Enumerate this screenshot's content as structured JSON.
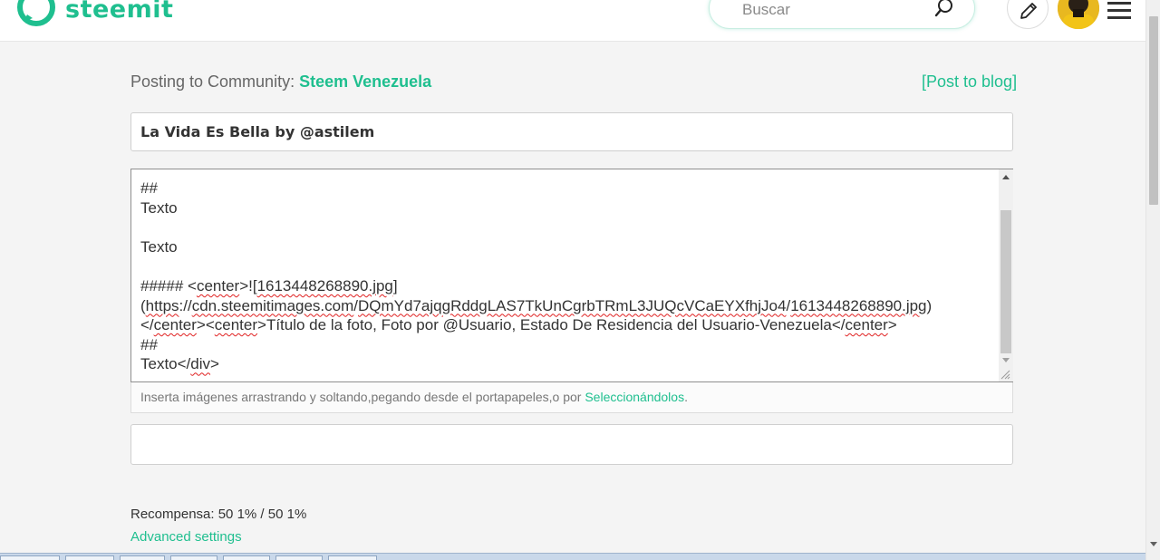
{
  "header": {
    "logo_text": "steemit",
    "search_placeholder": "Buscar"
  },
  "editor_meta": {
    "posting_prefix": "Posting to Community:",
    "community_name": "Steem Venezuela",
    "post_to_blog": "[Post to blog]"
  },
  "title_value": "La Vida Es Bella by @astilem",
  "body_lines": {
    "l1": "##",
    "l2": "Texto",
    "l4": "Texto",
    "l6_a": "##### <",
    "l6_b": "center",
    "l6_c": ">![",
    "l6_d": "1613448268890.jpg",
    "l6_e": "]",
    "l7_a": "(",
    "l7_b": "https",
    "l7_c": "://",
    "l7_d": "cdn.steemitimages.com",
    "l7_e": "/",
    "l7_f": "DQmYd7ajqgRddgLAS7TkUnCgrbTRmL3JUQcVCaEYXfhjJo4",
    "l7_g": "/",
    "l7_h": "1613448268890.jpg",
    "l7_i": ")",
    "l8_a": "</",
    "l8_b": "center",
    "l8_c": "><",
    "l8_d": "center",
    "l8_e": ">Título de la foto, Foto por @Usuario, Estado De Residencia del Usuario-Venezuela</",
    "l8_f": "center",
    "l8_g": ">",
    "l9": "##",
    "l10_a": "Texto</",
    "l10_b": "div",
    "l10_c": ">"
  },
  "drop_hint": {
    "text": "Inserta imágenes arrastrando y soltando,pegando desde el portapapeles,o por ",
    "link": "Seleccionándolos",
    "end": "."
  },
  "tags_value": "",
  "reward_text": "Recompensa: 50 1% / 50 1%",
  "advanced_settings": "Advanced settings",
  "colors": {
    "brand": "#1fbf8f",
    "background": "#f4f4f4"
  },
  "icons": {
    "logo": "steemit-logo-icon",
    "search": "search-icon",
    "edit": "pencil-icon",
    "menu": "hamburger-menu-icon"
  }
}
